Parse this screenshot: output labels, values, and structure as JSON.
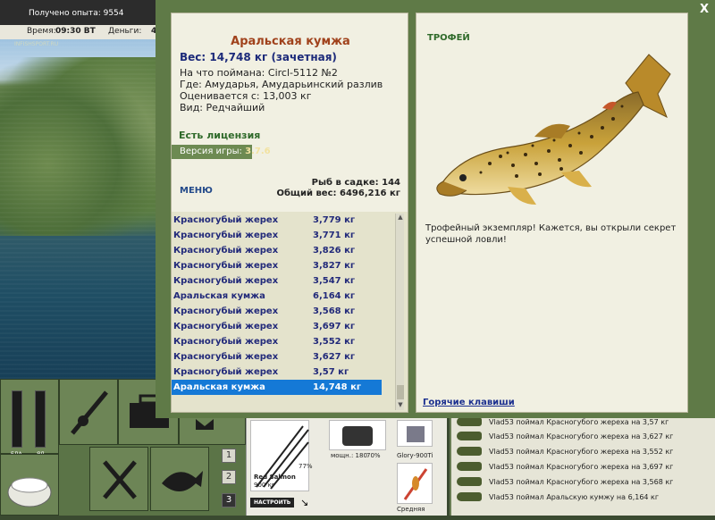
{
  "top": {
    "exp": "Получено опыта: 9554",
    "time_label": "Время:",
    "time_value": "09:30 ВТ",
    "money_label": "Деньги:",
    "money_value": "4",
    "site": "INFISHSPORT.RU"
  },
  "fish": {
    "title": "Аральская кумжа",
    "weight": "Вес: 14,748 кг (зачетная)",
    "caught_on": "На что поймана: Circl-5112 №2",
    "where": "Где: Амударья, Амударьинский разлив",
    "valued": "Оценивается с: 13,003 кг",
    "kind": "Вид: Редчайший"
  },
  "license": "Есть лицензия",
  "version_label": "Версия игры:",
  "version_value": "3.7.6",
  "menu_label": "МЕНЮ",
  "keepnet": {
    "count": "Рыб в садке: 144",
    "total": "Общий вес: 6496,216 кг"
  },
  "catch_list": [
    {
      "name": "Красногубый жерех",
      "weight": "3,779 кг"
    },
    {
      "name": "Красногубый жерех",
      "weight": "3,771 кг"
    },
    {
      "name": "Красногубый жерех",
      "weight": "3,826 кг"
    },
    {
      "name": "Красногубый жерех",
      "weight": "3,827 кг"
    },
    {
      "name": "Красногубый жерех",
      "weight": "3,547 кг"
    },
    {
      "name": "Аральская кумжа",
      "weight": "6,164 кг"
    },
    {
      "name": "Красногубый жерех",
      "weight": "3,568 кг"
    },
    {
      "name": "Красногубый жерех",
      "weight": "3,697 кг"
    },
    {
      "name": "Красногубый жерех",
      "weight": "3,552 кг"
    },
    {
      "name": "Красногубый жерех",
      "weight": "3,627 кг"
    },
    {
      "name": "Красногубый жерех",
      "weight": "3,57 кг"
    },
    {
      "name": "Аральская кумжа",
      "weight": "14,748 кг"
    }
  ],
  "trophy": {
    "header": "ТРОФЕЙ",
    "description": "Трофейный экземпляр! Кажется, вы открыли секрет успешной ловли!"
  },
  "hotkeys": "Горячие клавиши",
  "close_icon": "X",
  "gauges": {
    "left": "ЕДА",
    "right": "ЯД"
  },
  "slot_numbers": [
    "1",
    "2",
    "3"
  ],
  "tackle": {
    "line_name": "Red Salmon",
    "line_weight": "900 кг",
    "line_pct": "77%",
    "reel_power": "мощн.: 180",
    "reel_pct": "70%",
    "lure_name": "Glory-900Ti",
    "lure_level": "Средняя",
    "setup_btn": "НАСТРОИТЬ"
  },
  "chat": [
    "Vlad53 поймал Красногубого жереха на 3,57 кг",
    "Vlad53 поймал Красногубого жереха на 3,627 кг",
    "Vlad53 поймал Красногубого жереха на 3,552 кг",
    "Vlad53 поймал Красногубого жереха на 3,697 кг",
    "Vlad53 поймал Красногубого жереха на 3,568 кг",
    "Vlad53 поймал Аральскую кумжу на 6,164 кг"
  ]
}
